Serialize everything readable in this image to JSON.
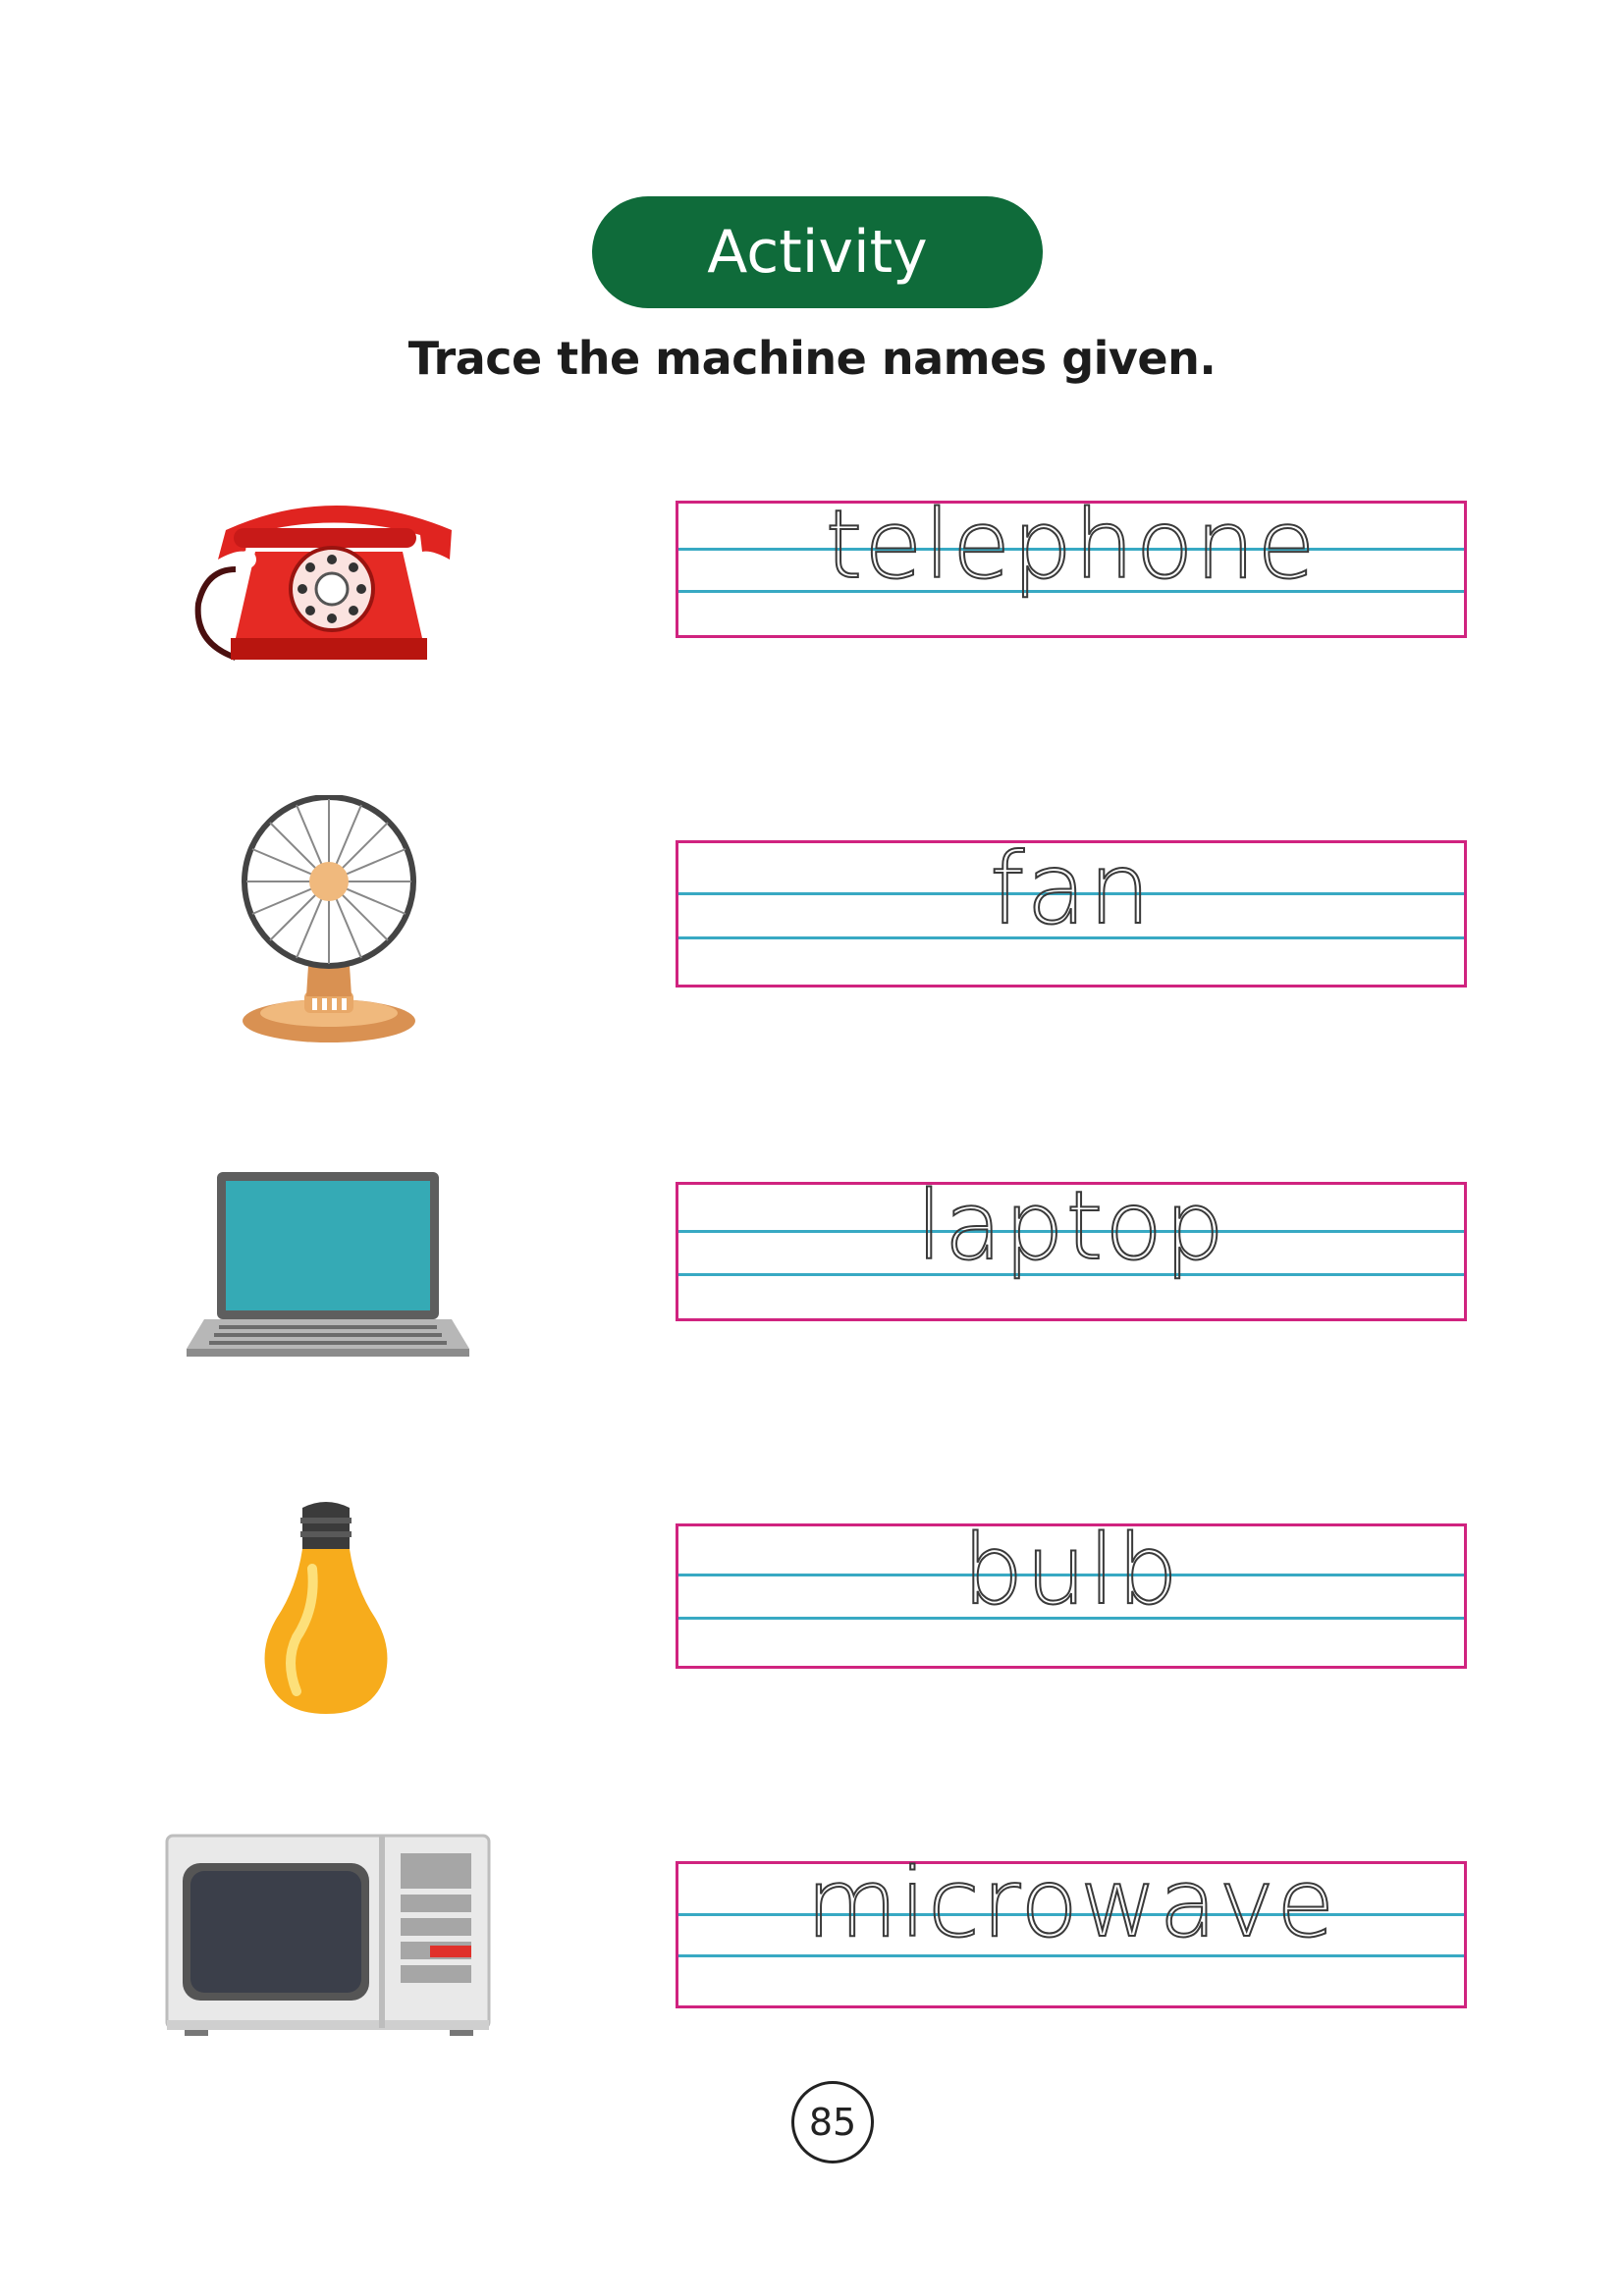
{
  "header": {
    "badge_label": "Activity",
    "instruction": "Trace the machine names given.",
    "badge_color": "#0f6b3a"
  },
  "items": [
    {
      "word": "telephone",
      "icon": "telephone-icon"
    },
    {
      "word": "fan",
      "icon": "fan-icon"
    },
    {
      "word": "laptop",
      "icon": "laptop-icon"
    },
    {
      "word": "bulb",
      "icon": "bulb-icon"
    },
    {
      "word": "microwave",
      "icon": "microwave-icon"
    }
  ],
  "colors": {
    "box_border": "#d0237f",
    "guide_lines": "#38a9c3"
  },
  "footer": {
    "page_number": "85"
  }
}
